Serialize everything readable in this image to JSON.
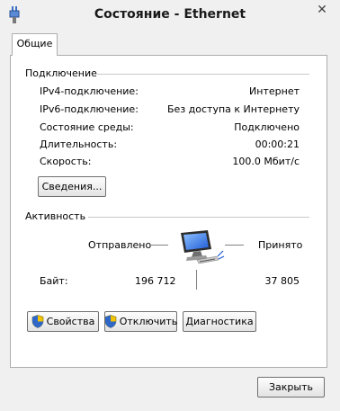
{
  "window": {
    "title": "Состояние - Ethernet",
    "close_glyph": "✕"
  },
  "tabs": [
    {
      "label": "Общие"
    }
  ],
  "connection": {
    "group_title": "Подключение",
    "rows": [
      {
        "label": "IPv4-подключение:",
        "value": "Интернет"
      },
      {
        "label": "IPv6-подключение:",
        "value": "Без доступа к Интернету"
      },
      {
        "label": "Состояние среды:",
        "value": "Подключено"
      },
      {
        "label": "Длительность:",
        "value": "00:00:21"
      },
      {
        "label": "Скорость:",
        "value": "100.0 Мбит/с"
      }
    ],
    "details_button": "Сведения..."
  },
  "activity": {
    "group_title": "Активность",
    "sent_label": "Отправлено",
    "received_label": "Принято",
    "bytes_label": "Байт:",
    "bytes_sent": "196 712",
    "bytes_received": "37 805"
  },
  "buttons": {
    "properties": "Свойства",
    "disable": "Отключить",
    "diagnose": "Диагностика",
    "close": "Закрыть"
  },
  "icons": {
    "app": "network-adapter-icon",
    "activity": "network-computer-icon",
    "shield": "uac-shield-icon"
  },
  "colors": {
    "accent": "#1e5bd6",
    "shield_yellow": "#f2c300"
  }
}
